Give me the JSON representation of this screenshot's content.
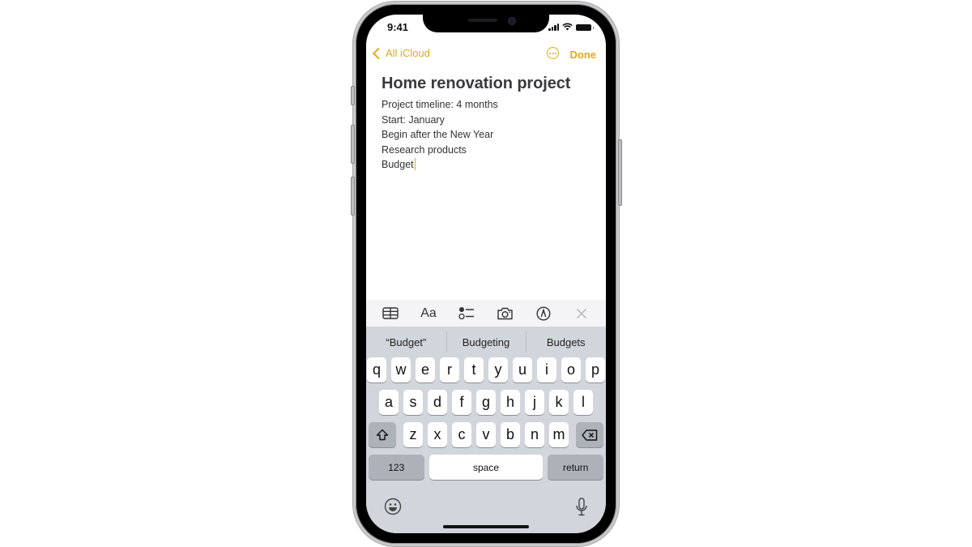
{
  "status_bar": {
    "time": "9:41"
  },
  "nav": {
    "back_label": "All iCloud",
    "done_label": "Done",
    "more_icon": "ellipsis-circle-icon"
  },
  "note": {
    "title": "Home renovation project",
    "lines": [
      "Project timeline: 4 months",
      "Start: January",
      "Begin after the New Year",
      "Research products",
      "Budget"
    ]
  },
  "toolbar": {
    "items": [
      {
        "name": "table",
        "icon": "table-icon"
      },
      {
        "name": "format",
        "label": "Aa",
        "icon": "text-format-icon"
      },
      {
        "name": "checklist",
        "icon": "checklist-icon"
      },
      {
        "name": "camera",
        "icon": "camera-icon"
      },
      {
        "name": "markup",
        "icon": "markup-pen-icon"
      },
      {
        "name": "close",
        "icon": "close-icon"
      }
    ]
  },
  "keyboard": {
    "suggestions": [
      "“Budget”",
      "Budgeting",
      "Budgets"
    ],
    "row1": [
      "q",
      "w",
      "e",
      "r",
      "t",
      "y",
      "u",
      "i",
      "o",
      "p"
    ],
    "row2": [
      "a",
      "s",
      "d",
      "f",
      "g",
      "h",
      "j",
      "k",
      "l"
    ],
    "row3": [
      "z",
      "x",
      "c",
      "v",
      "b",
      "n",
      "m"
    ],
    "numbers_label": "123",
    "space_label": "space",
    "return_label": "return"
  },
  "colors": {
    "accent": "#e0aa1a",
    "keyboard_bg": "#d2d5db",
    "toolbar_bg": "#f4f4f6"
  }
}
